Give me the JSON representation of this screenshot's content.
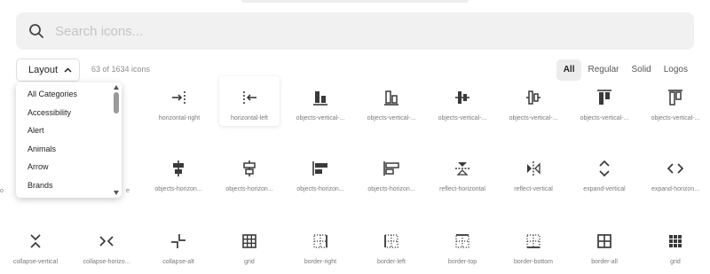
{
  "search": {
    "placeholder": "Search icons..."
  },
  "toolbar": {
    "layout_label": "Layout",
    "count_text": "63 of 1634 icons",
    "filters": [
      {
        "label": "All",
        "active": true
      },
      {
        "label": "Regular",
        "active": false
      },
      {
        "label": "Solid",
        "active": false
      },
      {
        "label": "Logos",
        "active": false
      }
    ]
  },
  "dropdown": {
    "options": [
      "All Categories",
      "Accessibility",
      "Alert",
      "Animals",
      "Arrow",
      "Brands"
    ]
  },
  "icons": {
    "row1": [
      {
        "name": "horizontal-right",
        "icon": "horizontal-right-icon"
      },
      {
        "name": "horizontal-left",
        "icon": "horizontal-left-icon"
      },
      {
        "name": "objects-vertical-...",
        "icon": "objects-vertical-bottom-icon"
      },
      {
        "name": "objects-vertical-...",
        "icon": "objects-vertical-bottom-outline-icon"
      },
      {
        "name": "objects-vertical-...",
        "icon": "objects-vertical-center-icon"
      },
      {
        "name": "objects-vertical-...",
        "icon": "objects-vertical-center-outline-icon"
      },
      {
        "name": "objects-vertical-...",
        "icon": "objects-vertical-top-icon"
      },
      {
        "name": "objects-vertical-...",
        "icon": "objects-vertical-top-outline-icon"
      }
    ],
    "row2": [
      {
        "name": "objects-horizon...",
        "icon": "objects-horizontal-center-icon"
      },
      {
        "name": "objects-horizon...",
        "icon": "objects-horizontal-center-outline-icon"
      },
      {
        "name": "objects-horizon...",
        "icon": "objects-horizontal-left-icon"
      },
      {
        "name": "objects-horizon...",
        "icon": "objects-horizontal-left-outline-icon"
      },
      {
        "name": "reflect-horizontal",
        "icon": "reflect-horizontal-icon"
      },
      {
        "name": "reflect-vertical",
        "icon": "reflect-vertical-icon"
      },
      {
        "name": "expand-vertical",
        "icon": "expand-vertical-icon"
      },
      {
        "name": "expand-horizon...",
        "icon": "expand-horizontal-icon"
      }
    ],
    "row3": [
      {
        "name": "collapse-vertical",
        "icon": "collapse-vertical-icon"
      },
      {
        "name": "collapse-horizo...",
        "icon": "collapse-horizontal-icon"
      },
      {
        "name": "collapse-alt",
        "icon": "collapse-alt-icon"
      },
      {
        "name": "grid",
        "icon": "grid-icon"
      },
      {
        "name": "border-right",
        "icon": "border-right-icon"
      },
      {
        "name": "border-left",
        "icon": "border-left-icon"
      },
      {
        "name": "border-top",
        "icon": "border-top-icon"
      },
      {
        "name": "border-bottom",
        "icon": "border-bottom-icon"
      },
      {
        "name": "border-all",
        "icon": "border-all-icon"
      },
      {
        "name": "grid",
        "icon": "grid-dots-icon"
      }
    ]
  },
  "peek_labels": {
    "row2_left": "o",
    "row2_left2": "e"
  },
  "colors": {
    "icon": "#3a3a3a",
    "label": "#7a7a7a",
    "search_bg": "#f1f1f1",
    "active_filter_bg": "#ececec"
  }
}
